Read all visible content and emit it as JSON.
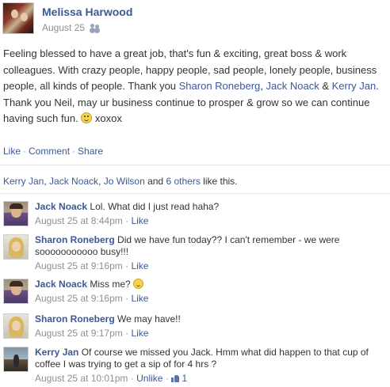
{
  "post": {
    "author": "Melissa Harwood",
    "date": "August 25",
    "audience_icon": "friends-icon",
    "text_parts": {
      "p1": "Feeling blessed to have a great job, that's fun & exciting, great boss & work colleagues. With crazy people, happy people, sad people, lonely people, business people, all kinds of people. Thank you ",
      "tag1": "Sharon Roneberg",
      "sep1": ", ",
      "tag2": "Jack Noack",
      "sep2": " & ",
      "tag3": "Kerry Jan",
      "p2": ". Thank you Neil, may ur business continue to prosper & grow so we can continue having such fun. ",
      "p3": " xoxox"
    },
    "actions": {
      "like": "Like",
      "comment": "Comment",
      "share": "Share",
      "separator": "·"
    }
  },
  "likes": {
    "name1": "Kerry Jan",
    "name2": "Jack Noack",
    "name3": "Jo Wilson",
    "joiner1": ", ",
    "joiner2": ", ",
    "and": " and ",
    "others": "6 others",
    "suffix": " like this."
  },
  "comments": [
    {
      "author": "Jack Noack",
      "text": "Lol. What did I just read haha?",
      "time": "August 25 at 8:44pm",
      "action": "Like",
      "separator": "·"
    },
    {
      "author": "Sharon Roneberg",
      "text": "Did we have fun today?? I can't remember - we were sooooooooooo busy!!!",
      "time": "August 25 at 9:16pm",
      "action": "Like",
      "separator": "·"
    },
    {
      "author": "Jack Noack",
      "text": "Miss me?",
      "time": "August 25 at 9:16pm",
      "action": "Like",
      "separator": "·"
    },
    {
      "author": "Sharon Roneberg",
      "text": "We may have!!",
      "time": "August 25 at 9:17pm",
      "action": "Like",
      "separator": "·"
    },
    {
      "author": "Kerry Jan",
      "text": "Of course we missed you Jack. Hmm what did happen to that cup of coffee I was trying to get a sip of for 4 hrs ?",
      "time": "August 25 at 10:01pm",
      "action": "Unlike",
      "separator": "·",
      "like_count": "1"
    }
  ]
}
